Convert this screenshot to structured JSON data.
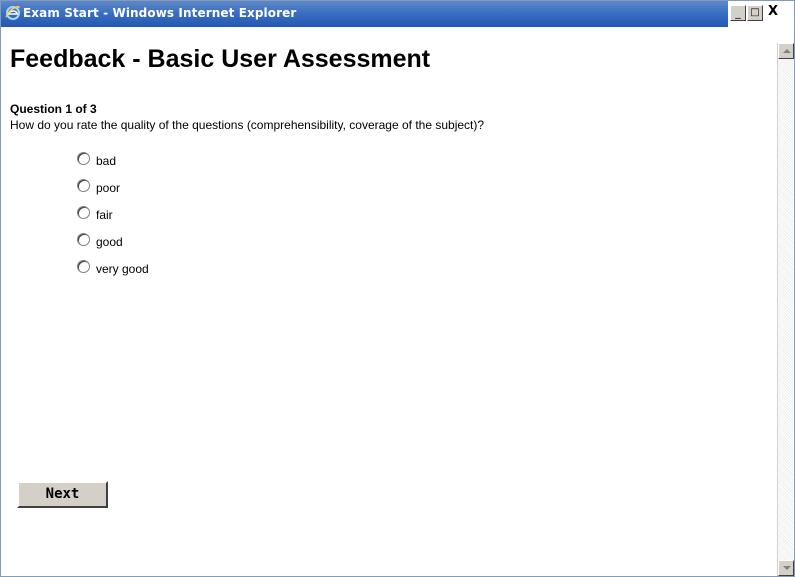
{
  "window": {
    "title": "Exam Start - Windows Internet Explorer",
    "buttons": {
      "minimize": "_",
      "maximize": "□",
      "close": "X"
    },
    "icon": "ie-icon"
  },
  "page": {
    "title": "Feedback - Basic User Assessment"
  },
  "question": {
    "number_label": "Question 1 of 3",
    "text": "How do you rate the quality of the questions (comprehensibility, coverage of the subject)?",
    "options": [
      "bad",
      "poor",
      "fair",
      "good",
      "very good"
    ],
    "selected": null
  },
  "actions": {
    "next_label": "Next"
  },
  "colors": {
    "titlebar": "#2458b3",
    "button_face": "#d4d0c8"
  }
}
